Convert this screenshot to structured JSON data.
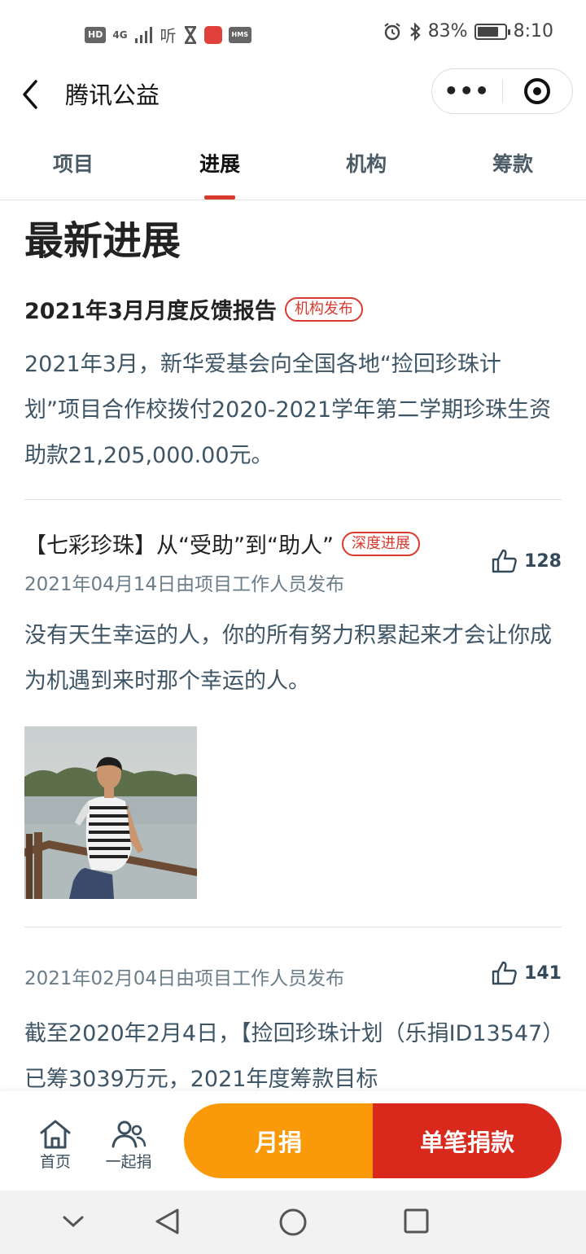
{
  "status_bar": {
    "left_chips": [
      "HD",
      "4G"
    ],
    "listen_text": "听",
    "hms_label": "HMS",
    "battery_text": "83%",
    "battery_level_percent": 83,
    "time": "8:10"
  },
  "header": {
    "title": "腾讯公益",
    "more_label": "•••"
  },
  "tabs": [
    {
      "label": "项目",
      "active": false
    },
    {
      "label": "进展",
      "active": true
    },
    {
      "label": "机构",
      "active": false
    },
    {
      "label": "筹款",
      "active": false
    }
  ],
  "main": {
    "section_title": "最新进展",
    "posts": [
      {
        "title": "2021年3月月度反馈报告",
        "tag": "机构发布",
        "body": "2021年3月，新华爱基会向全国各地“捡回珍珠计划”项目合作校拨付2020-2021学年第二学期珍珠生资助款21,205,000.00元。"
      },
      {
        "title": "【七彩珍珠】从“受助”到“助人”",
        "tag": "深度进展",
        "meta": "2021年04月14日由项目工作人员发布",
        "likes": "128",
        "body": "没有天生幸运的人，你的所有努力积累起来才会让你成为机遇到来时那个幸运的人。"
      },
      {
        "meta": "2021年02月04日由项目工作人员发布",
        "likes": "141",
        "body": "截至2020年2月4日，【捡回珍珠计划（乐捐ID13547）已筹3039万元，2021年度筹款目标"
      }
    ]
  },
  "action_bar": {
    "home_label": "首页",
    "together_label": "一起捐",
    "monthly_label": "月捐",
    "single_label": "单笔捐款"
  },
  "colors": {
    "accent_red": "#d9291c",
    "accent_orange": "#fb9a09"
  }
}
